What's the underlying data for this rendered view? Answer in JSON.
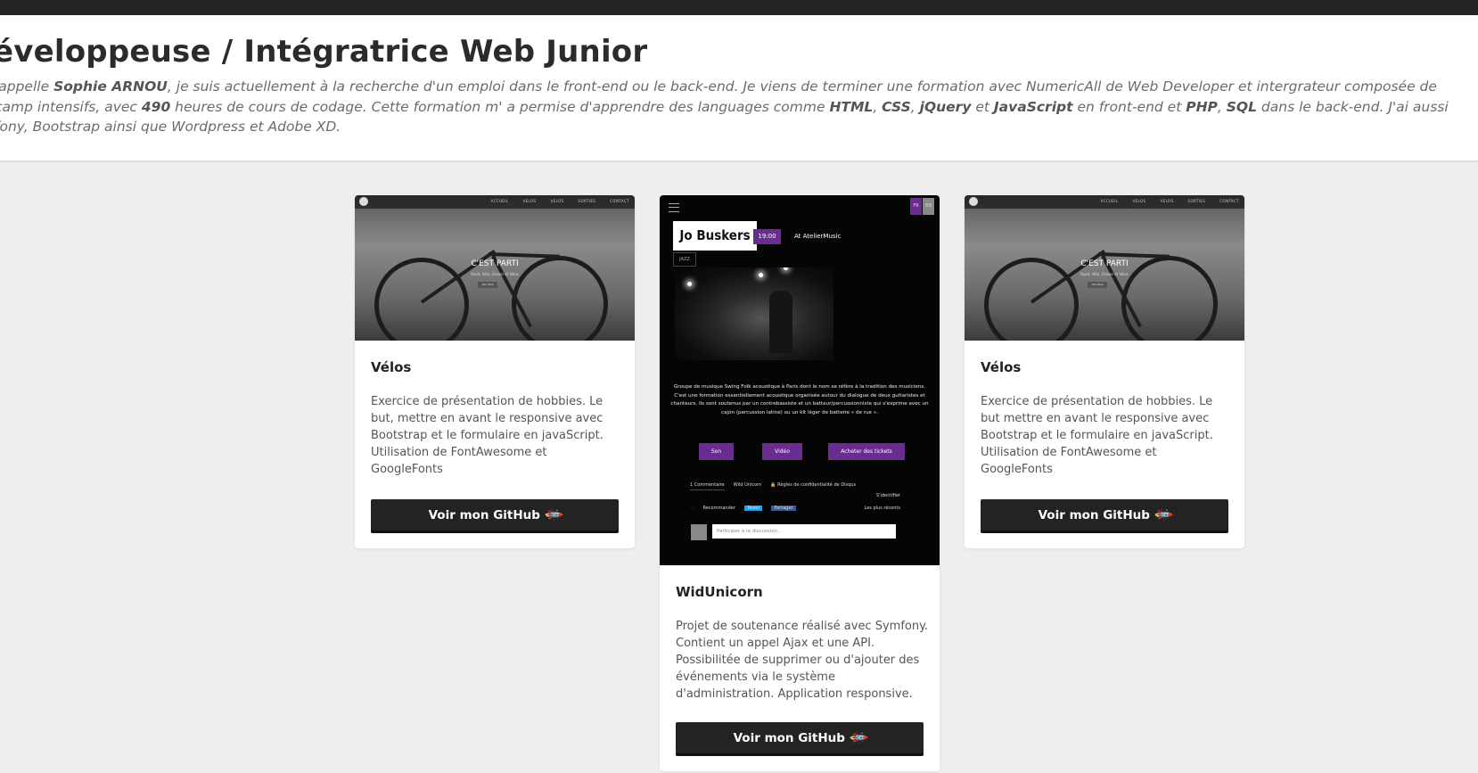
{
  "header": {
    "title": "éveloppeuse / Intégratrice Web Junior",
    "intro_lines": [
      [
        "'appelle ",
        {
          "b": "Sophie ARNOU"
        },
        ", je suis actuellement à la recherche d'un emploi dans le front-end ou le back-end. Je viens de terminer une formation avec NumericAll de Web Developer et intergrateur composée de"
      ],
      [
        "camp intensifs, avec ",
        {
          "b": "490"
        },
        " heures de cours de codage. Cette formation m' a permise d'apprendre des languages comme ",
        {
          "b": "HTML"
        },
        ", ",
        {
          "b": "CSS"
        },
        ", ",
        {
          "b": "jQuery"
        },
        " et ",
        {
          "b": "JavaScript"
        },
        " en front-end et ",
        {
          "b": "PHP"
        },
        ", ",
        {
          "b": "SQL"
        },
        " dans le back-end. J'ai aussi"
      ],
      [
        "fony, Bootstrap ainsi que Wordpress et Adobe XD."
      ]
    ]
  },
  "cards": [
    {
      "title": "Vélos",
      "description": "Exercice de présentation de hobbies. Le but, mettre en avant le responsive avec Bootstrap et le formulaire en javaScript. Utilisation de FontAwesome et GoogleFonts",
      "button": "Voir mon GitHub",
      "thumb_nav": [
        "ACCUEIL",
        "VELOS",
        "VELOS",
        "SORTIES",
        "CONTACT"
      ],
      "thumb_title": "C'EST PARTI",
      "thumb_sub": "Road, Vélo, Gravel et Vélos",
      "thumb_cta": "Voir Plus"
    },
    {
      "title": "WidUnicorn",
      "description": "Projet de soutenance réalisé avec Symfony. Contient un appel Ajax et une API. Possibilitée de supprimer ou d'ajouter des événements via le système d'administration. Application responsive.",
      "button": "Voir mon GitHub",
      "thumb": {
        "lang": [
          "FR",
          "EN"
        ],
        "artist": "Jo Buskers",
        "time": "19:00",
        "venue": "At AtelierMusic",
        "genre": "JAZZ",
        "text": "Groupe de musique Swing Folk acoustique à Paris dont le nom se réfère à la tradition des musiciens. C'est une formation essentiellement acoustique organisée autour du dialogue de deux guitaristes et chanteurs. Ils sont soutenus par un contrebassiste et un batteur/percussionniste qui s'exprime avec un cajón (percussion latine) ou un kit léger de batterie « de rue ».",
        "buttons": [
          "Son",
          "Vidéo",
          "Acheter des tickets"
        ],
        "disqus_tabs": [
          "1 Commentaire",
          "Wild Unicorn",
          "🔒 Règles de confidentialité de Disqus"
        ],
        "login": "S'identifier",
        "recommend": "Recommander",
        "tweet": "Tweet",
        "share": "Partager",
        "sort": "Les plus récents",
        "placeholder": "Participer à la discussion..."
      }
    },
    {
      "title": "Vélos",
      "description": "Exercice de présentation de hobbies. Le but mettre en avant le responsive avec Bootstrap et le formulaire en javaScript. Utilisation de FontAwesome et GoogleFonts",
      "button": "Voir mon GitHub",
      "thumb_nav": [
        "ACCUEIL",
        "VELOS",
        "VELOS",
        "SORTIES",
        "CONTACT"
      ],
      "thumb_title": "C'EST PARTI",
      "thumb_sub": "Road, Vélo, Gravel et Vélos",
      "thumb_cta": "Voir Plus"
    }
  ],
  "icons": {
    "rocket": "rocket-icon"
  },
  "colors": {
    "accent": "#6a2c91",
    "dark": "#232323",
    "background": "#eeeeee"
  }
}
